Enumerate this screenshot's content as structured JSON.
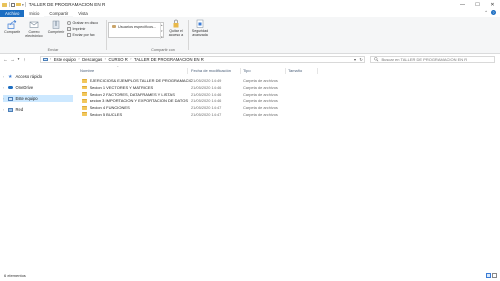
{
  "window": {
    "title": "TALLER DE PROGRAMACION EN R",
    "controls": [
      "—",
      "☐",
      "✕"
    ]
  },
  "ribbon": {
    "tabs": [
      "Archivo",
      "Inicio",
      "Compartir",
      "Vista"
    ],
    "active_tab": "Archivo",
    "groups": {
      "send": {
        "label": "Enviar",
        "compartir": "Compartir",
        "correo": "Correo electrónico",
        "comprimir": "Comprimir",
        "grabar": "Grabar en disco",
        "imprimir": "Imprimir",
        "fax": "Enviar por fax"
      },
      "share": {
        "label": "Compartir con",
        "users_option": "Usuarios específicos...",
        "quitar": "Quitar el acceso a",
        "seguridad": "Seguridad avanzada"
      }
    }
  },
  "address": {
    "path": [
      "Este equipo",
      "Descargas",
      "CURSO R",
      "TALLER DE PROGRAMACION EN R"
    ],
    "search_placeholder": "Buscar en TALLER DE PROGRAMACION EN R"
  },
  "nav": {
    "items": [
      {
        "label": "Acceso rápido",
        "icon": "star-icon"
      },
      {
        "label": "OneDrive",
        "icon": "cloud-icon"
      },
      {
        "label": "Este equipo",
        "icon": "computer-icon",
        "selected": true
      },
      {
        "label": "Red",
        "icon": "network-icon"
      }
    ]
  },
  "columns": {
    "name": "Nombre",
    "date": "Fecha de modificación",
    "type": "Tipo",
    "size": "Tamaño"
  },
  "files": [
    {
      "name": "EJERCICIOS& EJEMPLOS  TALLER DE PROGRAMACION EN R",
      "date": "21/05/2020 14:49",
      "type": "Carpeta de archivos"
    },
    {
      "name": "Secion 1 VECTORES Y MATRICES",
      "date": "21/05/2020 14:46",
      "type": "Carpeta de archivos"
    },
    {
      "name": "Secion 2 FACTORES, DATAFRAMES Y LISTAS",
      "date": "21/05/2020 14:46",
      "type": "Carpeta de archivos"
    },
    {
      "name": "secion 3 IMPORTACION Y EXPORTACION DE DATOS",
      "date": "21/05/2020 14:46",
      "type": "Carpeta de archivos"
    },
    {
      "name": "Secion 4 FUNCIONES",
      "date": "21/05/2020 14:47",
      "type": "Carpeta de archivos"
    },
    {
      "name": "Secion 5 BUCLES",
      "date": "21/05/2020 14:47",
      "type": "Carpeta de archivos"
    }
  ],
  "status": {
    "count": "6 elementos"
  },
  "colors": {
    "accent": "#1c6ec2",
    "folder": "#f2c75c",
    "selection": "#cce8ff"
  }
}
